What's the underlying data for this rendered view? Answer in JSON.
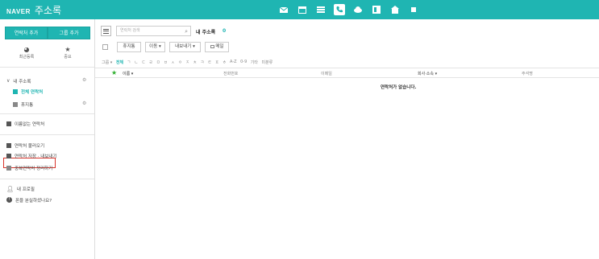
{
  "header": {
    "logo": "NAVER",
    "service": "주소록",
    "apps": [
      {
        "name": "mail-icon",
        "active": false
      },
      {
        "name": "calendar-icon",
        "active": false
      },
      {
        "name": "list-icon",
        "active": false
      },
      {
        "name": "contacts-icon",
        "active": true
      },
      {
        "name": "cloud-icon",
        "active": false
      },
      {
        "name": "office-icon",
        "active": false
      },
      {
        "name": "home-icon",
        "active": false
      },
      {
        "name": "more-icon",
        "active": false
      }
    ]
  },
  "sidebar": {
    "add_contact": "연락처 추가",
    "add_group": "그룹 추가",
    "quick": [
      {
        "icon": "clock-icon",
        "label": "최근등록"
      },
      {
        "icon": "star-icon",
        "label": "중요"
      }
    ],
    "my_book": "내 주소록",
    "items": {
      "all": "전체 연락처",
      "trash": "휴지통",
      "no_name": "이름없는 연락처",
      "import": "연락처 불러오기",
      "export": "연락처 저장 · 내보내기",
      "duplicate": "중복연락처 정리하기",
      "profile": "내 프로필",
      "lost_phone": "폰을 분실하셨나요?"
    }
  },
  "main": {
    "search_placeholder": "연락처 검색",
    "title": "내 주소록",
    "count": "0",
    "toolbar": {
      "delete": "휴지통",
      "move": "이동 ▾",
      "export": "내보내기 ▾",
      "mail": "메일"
    },
    "filters": [
      "그룹 ▾",
      "전체",
      "ㄱ",
      "ㄴ",
      "ㄷ",
      "ㄹ",
      "ㅁ",
      "ㅂ",
      "ㅅ",
      "ㅇ",
      "ㅈ",
      "ㅊ",
      "ㅋ",
      "ㅌ",
      "ㅍ",
      "ㅎ",
      "A-Z",
      "0-9",
      "기타",
      "미분류"
    ],
    "columns": {
      "name": "이름 ▾",
      "phone": "전화번호",
      "email": "이메일",
      "company": "회사·소속 ▾",
      "memo": "주석명"
    },
    "empty_message": "연락처가 없습니다."
  },
  "colors": {
    "accent": "#1fb5b2",
    "highlight": "#d8332a",
    "star": "#2dae2d"
  }
}
